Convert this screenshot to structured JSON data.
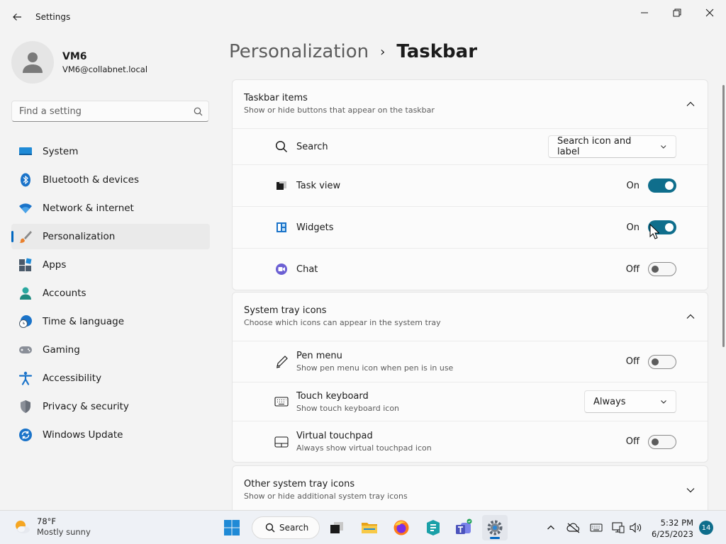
{
  "window": {
    "title": "Settings"
  },
  "profile": {
    "name": "VM6",
    "email": "VM6@collabnet.local"
  },
  "search": {
    "placeholder": "Find a setting"
  },
  "sidebar": {
    "items": [
      {
        "label": "System",
        "icon": "monitor-icon"
      },
      {
        "label": "Bluetooth & devices",
        "icon": "bluetooth-icon"
      },
      {
        "label": "Network & internet",
        "icon": "wifi-icon"
      },
      {
        "label": "Personalization",
        "icon": "brush-icon",
        "active": true
      },
      {
        "label": "Apps",
        "icon": "apps-icon"
      },
      {
        "label": "Accounts",
        "icon": "accounts-icon"
      },
      {
        "label": "Time & language",
        "icon": "globe-clock-icon"
      },
      {
        "label": "Gaming",
        "icon": "gamepad-icon"
      },
      {
        "label": "Accessibility",
        "icon": "accessibility-icon"
      },
      {
        "label": "Privacy & security",
        "icon": "shield-icon"
      },
      {
        "label": "Windows Update",
        "icon": "update-icon"
      }
    ]
  },
  "breadcrumb": {
    "parent": "Personalization",
    "current": "Taskbar"
  },
  "taskbar_items": {
    "title": "Taskbar items",
    "subtitle": "Show or hide buttons that appear on the taskbar",
    "rows": [
      {
        "label": "Search",
        "control": "dropdown",
        "value": "Search icon and label"
      },
      {
        "label": "Task view",
        "control": "toggle",
        "state": "On"
      },
      {
        "label": "Widgets",
        "control": "toggle",
        "state": "On"
      },
      {
        "label": "Chat",
        "control": "toggle",
        "state": "Off"
      }
    ]
  },
  "system_tray": {
    "title": "System tray icons",
    "subtitle": "Choose which icons can appear in the system tray",
    "rows": [
      {
        "label": "Pen menu",
        "sub": "Show pen menu icon when pen is in use",
        "control": "toggle",
        "state": "Off"
      },
      {
        "label": "Touch keyboard",
        "sub": "Show touch keyboard icon",
        "control": "dropdown",
        "value": "Always"
      },
      {
        "label": "Virtual touchpad",
        "sub": "Always show virtual touchpad icon",
        "control": "toggle",
        "state": "Off"
      }
    ]
  },
  "other_tray": {
    "title": "Other system tray icons",
    "subtitle": "Show or hide additional system tray icons"
  },
  "os_taskbar": {
    "weather_temp": "78°F",
    "weather_desc": "Mostly sunny",
    "search_label": "Search",
    "time": "5:32 PM",
    "date": "6/25/2023",
    "notifications": "14"
  },
  "colors": {
    "accent": "#0f6e8c",
    "nav_indicator": "#0067c0"
  }
}
